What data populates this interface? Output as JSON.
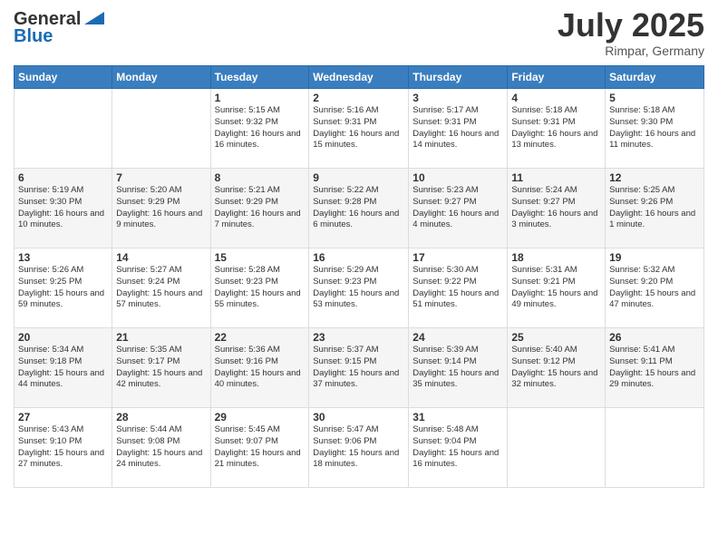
{
  "logo": {
    "line1": "General",
    "line2": "Blue"
  },
  "title": "July 2025",
  "location": "Rimpar, Germany",
  "days_header": [
    "Sunday",
    "Monday",
    "Tuesday",
    "Wednesday",
    "Thursday",
    "Friday",
    "Saturday"
  ],
  "weeks": [
    [
      {
        "day": "",
        "sunrise": "",
        "sunset": "",
        "daylight": ""
      },
      {
        "day": "",
        "sunrise": "",
        "sunset": "",
        "daylight": ""
      },
      {
        "day": "1",
        "sunrise": "Sunrise: 5:15 AM",
        "sunset": "Sunset: 9:32 PM",
        "daylight": "Daylight: 16 hours and 16 minutes."
      },
      {
        "day": "2",
        "sunrise": "Sunrise: 5:16 AM",
        "sunset": "Sunset: 9:31 PM",
        "daylight": "Daylight: 16 hours and 15 minutes."
      },
      {
        "day": "3",
        "sunrise": "Sunrise: 5:17 AM",
        "sunset": "Sunset: 9:31 PM",
        "daylight": "Daylight: 16 hours and 14 minutes."
      },
      {
        "day": "4",
        "sunrise": "Sunrise: 5:18 AM",
        "sunset": "Sunset: 9:31 PM",
        "daylight": "Daylight: 16 hours and 13 minutes."
      },
      {
        "day": "5",
        "sunrise": "Sunrise: 5:18 AM",
        "sunset": "Sunset: 9:30 PM",
        "daylight": "Daylight: 16 hours and 11 minutes."
      }
    ],
    [
      {
        "day": "6",
        "sunrise": "Sunrise: 5:19 AM",
        "sunset": "Sunset: 9:30 PM",
        "daylight": "Daylight: 16 hours and 10 minutes."
      },
      {
        "day": "7",
        "sunrise": "Sunrise: 5:20 AM",
        "sunset": "Sunset: 9:29 PM",
        "daylight": "Daylight: 16 hours and 9 minutes."
      },
      {
        "day": "8",
        "sunrise": "Sunrise: 5:21 AM",
        "sunset": "Sunset: 9:29 PM",
        "daylight": "Daylight: 16 hours and 7 minutes."
      },
      {
        "day": "9",
        "sunrise": "Sunrise: 5:22 AM",
        "sunset": "Sunset: 9:28 PM",
        "daylight": "Daylight: 16 hours and 6 minutes."
      },
      {
        "day": "10",
        "sunrise": "Sunrise: 5:23 AM",
        "sunset": "Sunset: 9:27 PM",
        "daylight": "Daylight: 16 hours and 4 minutes."
      },
      {
        "day": "11",
        "sunrise": "Sunrise: 5:24 AM",
        "sunset": "Sunset: 9:27 PM",
        "daylight": "Daylight: 16 hours and 3 minutes."
      },
      {
        "day": "12",
        "sunrise": "Sunrise: 5:25 AM",
        "sunset": "Sunset: 9:26 PM",
        "daylight": "Daylight: 16 hours and 1 minute."
      }
    ],
    [
      {
        "day": "13",
        "sunrise": "Sunrise: 5:26 AM",
        "sunset": "Sunset: 9:25 PM",
        "daylight": "Daylight: 15 hours and 59 minutes."
      },
      {
        "day": "14",
        "sunrise": "Sunrise: 5:27 AM",
        "sunset": "Sunset: 9:24 PM",
        "daylight": "Daylight: 15 hours and 57 minutes."
      },
      {
        "day": "15",
        "sunrise": "Sunrise: 5:28 AM",
        "sunset": "Sunset: 9:23 PM",
        "daylight": "Daylight: 15 hours and 55 minutes."
      },
      {
        "day": "16",
        "sunrise": "Sunrise: 5:29 AM",
        "sunset": "Sunset: 9:23 PM",
        "daylight": "Daylight: 15 hours and 53 minutes."
      },
      {
        "day": "17",
        "sunrise": "Sunrise: 5:30 AM",
        "sunset": "Sunset: 9:22 PM",
        "daylight": "Daylight: 15 hours and 51 minutes."
      },
      {
        "day": "18",
        "sunrise": "Sunrise: 5:31 AM",
        "sunset": "Sunset: 9:21 PM",
        "daylight": "Daylight: 15 hours and 49 minutes."
      },
      {
        "day": "19",
        "sunrise": "Sunrise: 5:32 AM",
        "sunset": "Sunset: 9:20 PM",
        "daylight": "Daylight: 15 hours and 47 minutes."
      }
    ],
    [
      {
        "day": "20",
        "sunrise": "Sunrise: 5:34 AM",
        "sunset": "Sunset: 9:18 PM",
        "daylight": "Daylight: 15 hours and 44 minutes."
      },
      {
        "day": "21",
        "sunrise": "Sunrise: 5:35 AM",
        "sunset": "Sunset: 9:17 PM",
        "daylight": "Daylight: 15 hours and 42 minutes."
      },
      {
        "day": "22",
        "sunrise": "Sunrise: 5:36 AM",
        "sunset": "Sunset: 9:16 PM",
        "daylight": "Daylight: 15 hours and 40 minutes."
      },
      {
        "day": "23",
        "sunrise": "Sunrise: 5:37 AM",
        "sunset": "Sunset: 9:15 PM",
        "daylight": "Daylight: 15 hours and 37 minutes."
      },
      {
        "day": "24",
        "sunrise": "Sunrise: 5:39 AM",
        "sunset": "Sunset: 9:14 PM",
        "daylight": "Daylight: 15 hours and 35 minutes."
      },
      {
        "day": "25",
        "sunrise": "Sunrise: 5:40 AM",
        "sunset": "Sunset: 9:12 PM",
        "daylight": "Daylight: 15 hours and 32 minutes."
      },
      {
        "day": "26",
        "sunrise": "Sunrise: 5:41 AM",
        "sunset": "Sunset: 9:11 PM",
        "daylight": "Daylight: 15 hours and 29 minutes."
      }
    ],
    [
      {
        "day": "27",
        "sunrise": "Sunrise: 5:43 AM",
        "sunset": "Sunset: 9:10 PM",
        "daylight": "Daylight: 15 hours and 27 minutes."
      },
      {
        "day": "28",
        "sunrise": "Sunrise: 5:44 AM",
        "sunset": "Sunset: 9:08 PM",
        "daylight": "Daylight: 15 hours and 24 minutes."
      },
      {
        "day": "29",
        "sunrise": "Sunrise: 5:45 AM",
        "sunset": "Sunset: 9:07 PM",
        "daylight": "Daylight: 15 hours and 21 minutes."
      },
      {
        "day": "30",
        "sunrise": "Sunrise: 5:47 AM",
        "sunset": "Sunset: 9:06 PM",
        "daylight": "Daylight: 15 hours and 18 minutes."
      },
      {
        "day": "31",
        "sunrise": "Sunrise: 5:48 AM",
        "sunset": "Sunset: 9:04 PM",
        "daylight": "Daylight: 15 hours and 16 minutes."
      },
      {
        "day": "",
        "sunrise": "",
        "sunset": "",
        "daylight": ""
      },
      {
        "day": "",
        "sunrise": "",
        "sunset": "",
        "daylight": ""
      }
    ]
  ]
}
